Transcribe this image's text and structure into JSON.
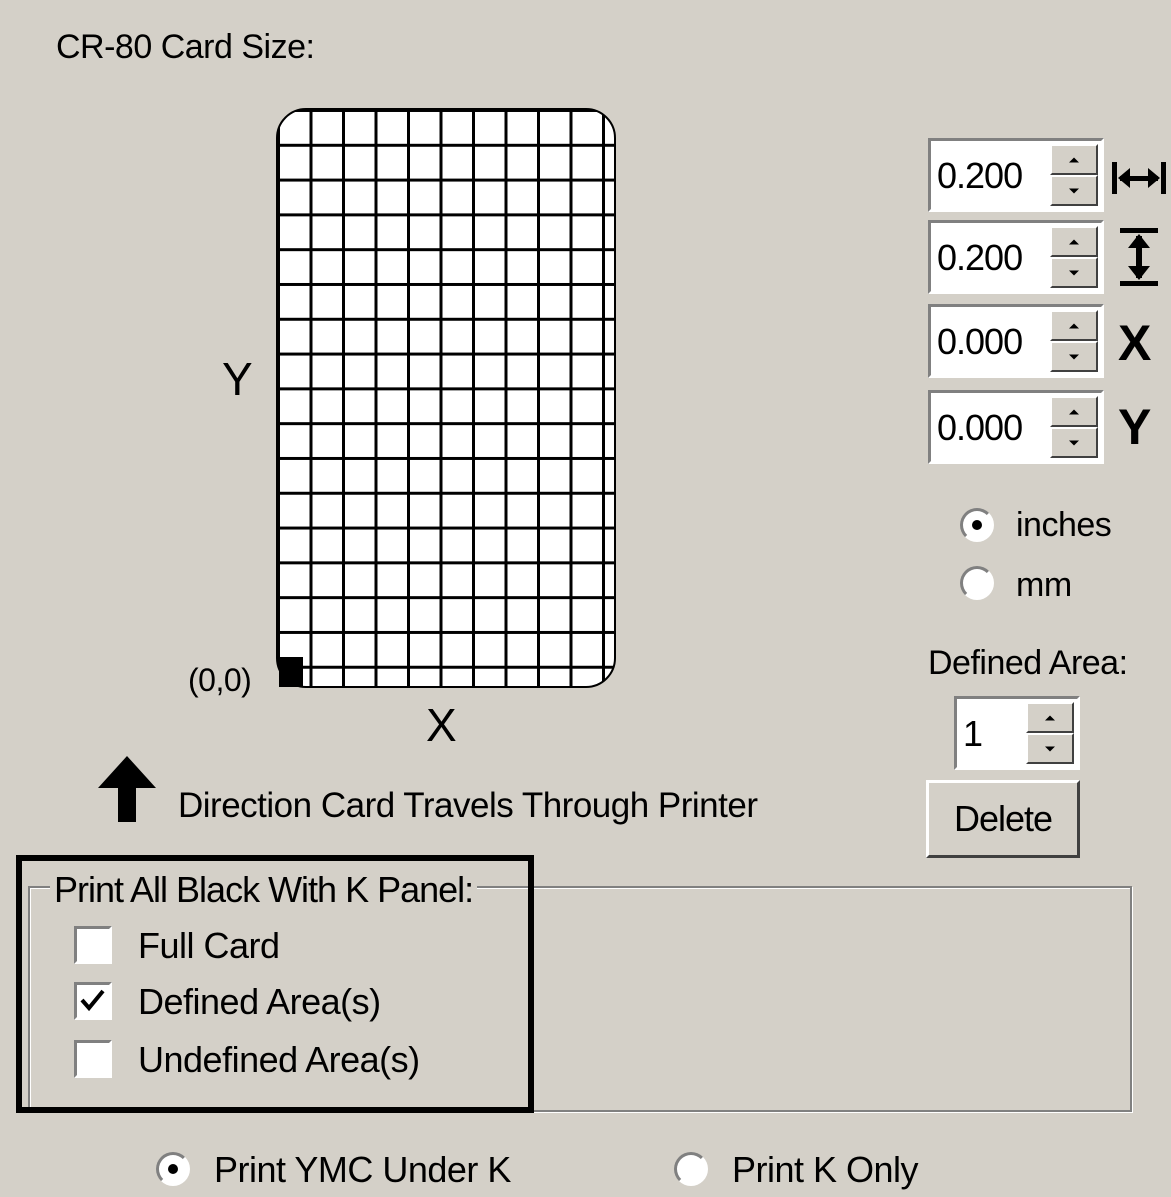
{
  "card": {
    "title": "CR-80 Card Size:",
    "y_axis_label": "Y",
    "x_axis_label": "X",
    "origin_label": "(0,0)",
    "direction_label": "Direction Card Travels Through Printer"
  },
  "fields": [
    {
      "name": "width",
      "value": "0.200",
      "icon": "horizontal-width-icon"
    },
    {
      "name": "height",
      "value": "0.200",
      "icon": "vertical-height-icon"
    },
    {
      "name": "x",
      "value": "0.000",
      "icon_text": "X"
    },
    {
      "name": "y",
      "value": "0.000",
      "icon_text": "Y"
    }
  ],
  "units": {
    "options": [
      "inches",
      "mm"
    ],
    "selected": "inches"
  },
  "defined_area": {
    "label": "Defined Area:",
    "value": "1",
    "delete_label": "Delete"
  },
  "k_panel": {
    "title": "Print All Black With K Panel:",
    "options": [
      {
        "label": "Full Card",
        "checked": false
      },
      {
        "label": "Defined Area(s)",
        "checked": true
      },
      {
        "label": "Undefined Area(s)",
        "checked": false
      }
    ]
  },
  "print_mode": {
    "options": [
      "Print YMC Under K",
      "Print K Only"
    ],
    "selected": "Print YMC Under K"
  }
}
